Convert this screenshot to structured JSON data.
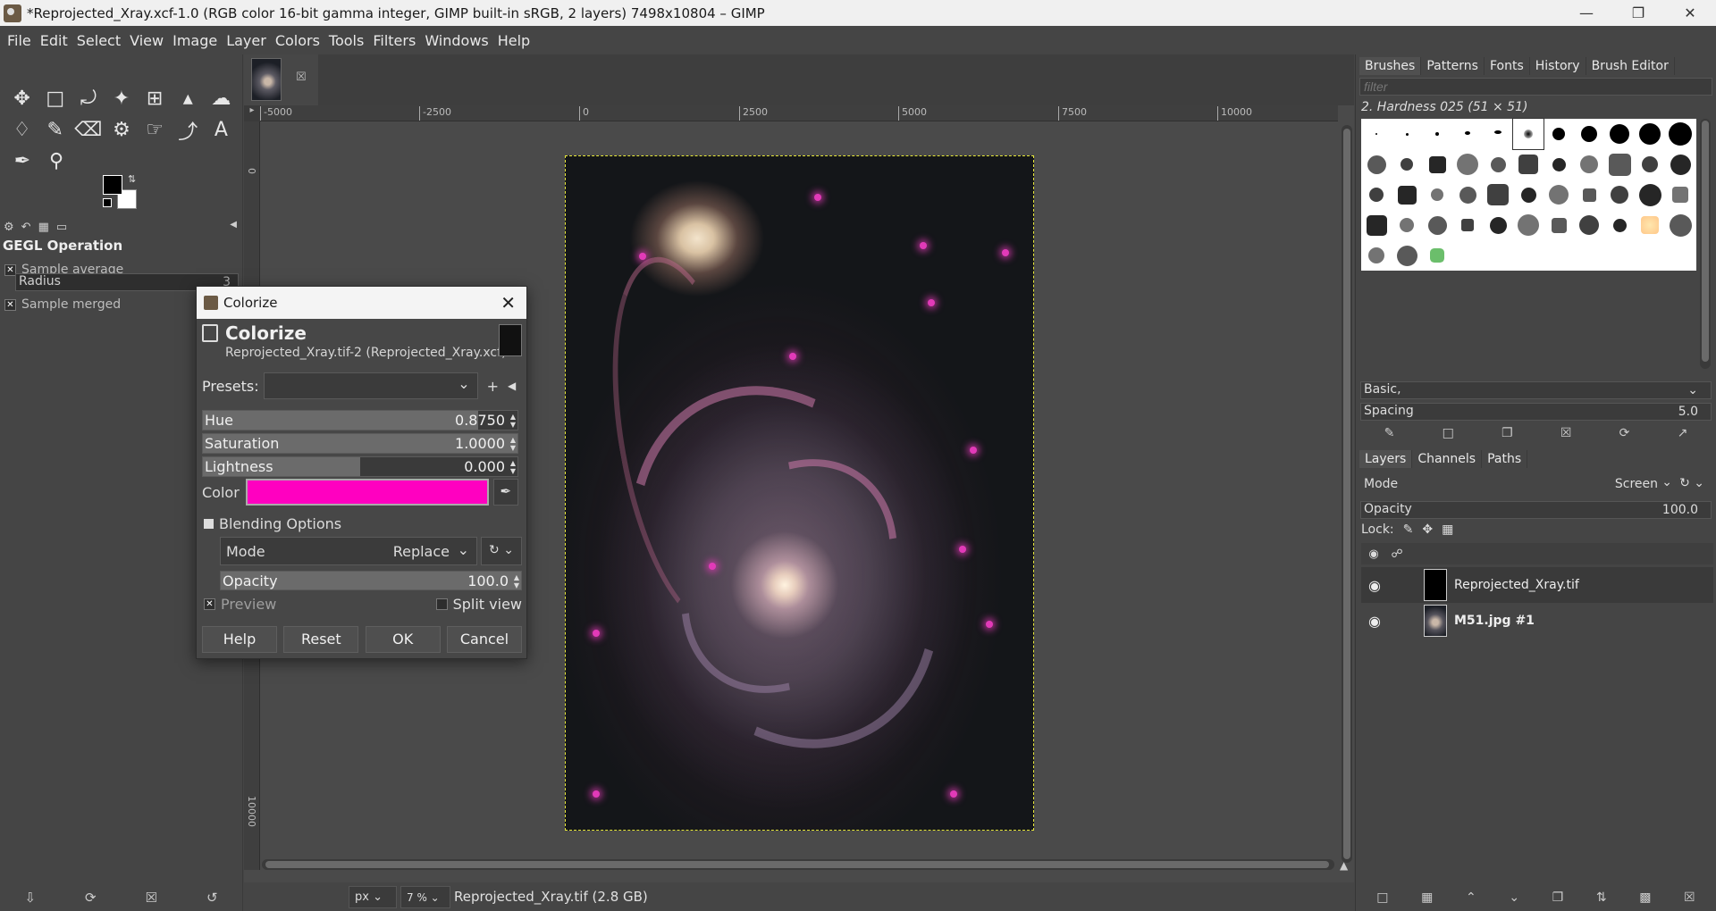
{
  "window": {
    "title": "*Reprojected_Xray.xcf-1.0 (RGB color 16-bit gamma integer, GIMP built-in sRGB, 2 layers) 7498x10804 – GIMP"
  },
  "menu": [
    "File",
    "Edit",
    "Select",
    "View",
    "Image",
    "Layer",
    "Colors",
    "Tools",
    "Filters",
    "Windows",
    "Help"
  ],
  "tool_options": {
    "title": "GEGL Operation",
    "sample_average": "Sample average",
    "radius_label": "Radius",
    "radius_value": "3",
    "sample_merged": "Sample merged"
  },
  "ruler": {
    "h_labels": [
      "-5000",
      "-2500",
      "0",
      "2500",
      "5000",
      "7500",
      "10000"
    ],
    "v_labels": [
      "0",
      "10000"
    ]
  },
  "statusbar": {
    "unit": "px",
    "zoom": "7 %",
    "text": "Reprojected_Xray.tif (2.8 GB)"
  },
  "right_dock": {
    "brush_tabs": [
      "Brushes",
      "Patterns",
      "Fonts",
      "History",
      "Brush Editor"
    ],
    "filter_placeholder": "filter",
    "brush_name": "2. Hardness 025 (51 × 51)",
    "preset_tag": "Basic,",
    "spacing_label": "Spacing",
    "spacing_value": "5.0",
    "layer_tabs": [
      "Layers",
      "Channels",
      "Paths"
    ],
    "mode_label": "Mode",
    "mode_value": "Screen",
    "opacity_label": "Opacity",
    "opacity_value": "100.0",
    "lock_label": "Lock:",
    "layers": [
      {
        "name": "Reprojected_Xray.tif",
        "selected": true
      },
      {
        "name": "M51.jpg #1",
        "selected": false
      }
    ]
  },
  "dialog": {
    "title": "Colorize",
    "heading": "Colorize",
    "subheading": "Reprojected_Xray.tif-2 (Reprojected_Xray.xcf)",
    "presets_label": "Presets:",
    "hue_label": "Hue",
    "hue_value": "0.8750",
    "hue_fraction": 0.875,
    "saturation_label": "Saturation",
    "saturation_value": "1.0000",
    "saturation_fraction": 1.0,
    "lightness_label": "Lightness",
    "lightness_value": "0.000",
    "lightness_fraction": 0.5,
    "color_label": "Color",
    "color_hex": "#ff00c0",
    "blending_label": "Blending Options",
    "mode_label": "Mode",
    "mode_value": "Replace",
    "opacity_label": "Opacity",
    "opacity_value": "100.0",
    "preview_label": "Preview",
    "split_view_label": "Split view",
    "buttons": {
      "help": "Help",
      "reset": "Reset",
      "ok": "OK",
      "cancel": "Cancel"
    }
  }
}
